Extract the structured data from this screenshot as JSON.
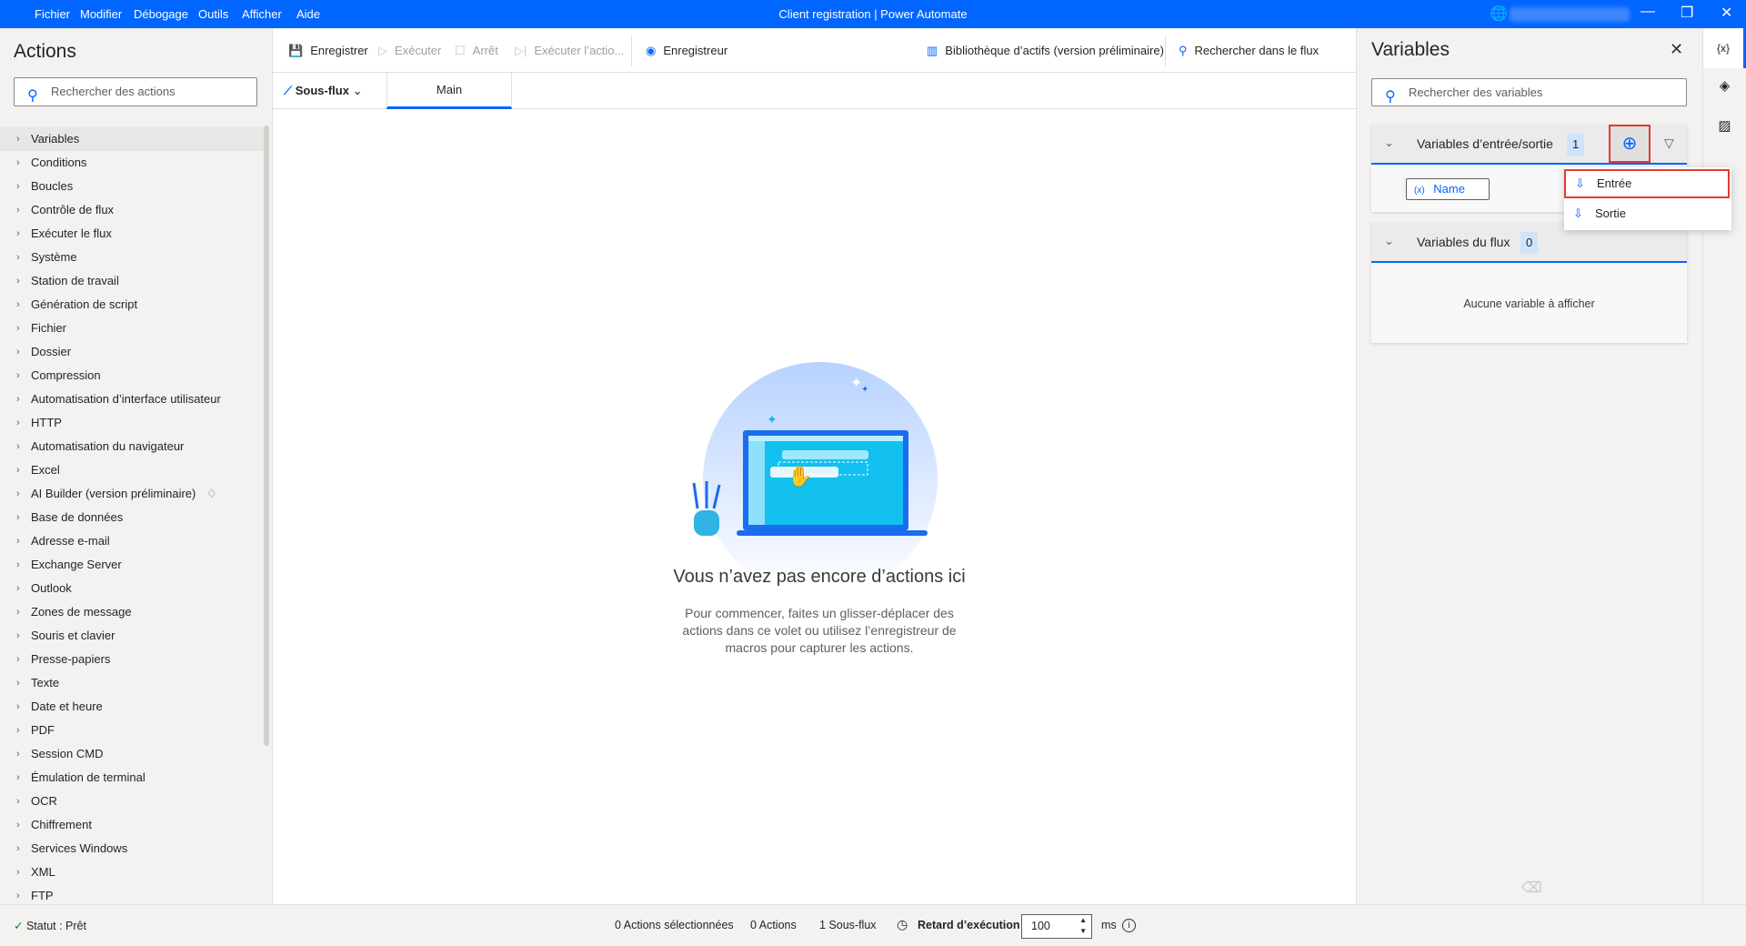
{
  "titlebar": {
    "menu": [
      "Fichier",
      "Modifier",
      "Débogage",
      "Outils",
      "Afficher",
      "Aide"
    ],
    "title": "Client registration | Power Automate"
  },
  "actions": {
    "title": "Actions",
    "search_placeholder": "Rechercher des actions",
    "items": [
      "Variables",
      "Conditions",
      "Boucles",
      "Contrôle de flux",
      "Exécuter le flux",
      "Système",
      "Station de travail",
      "Génération de script",
      "Fichier",
      "Dossier",
      "Compression",
      "Automatisation d’interface utilisateur",
      "HTTP",
      "Automatisation du navigateur",
      "Excel",
      "AI Builder (version préliminaire)",
      "Base de données",
      "Adresse e-mail",
      "Exchange Server",
      "Outlook",
      "Zones de message",
      "Souris et clavier",
      "Presse-papiers",
      "Texte",
      "Date et heure",
      "PDF",
      "Session CMD",
      "Émulation de terminal",
      "OCR",
      "Chiffrement",
      "Services Windows",
      "XML",
      "FTP"
    ]
  },
  "toolbar": {
    "save": "Enregistrer",
    "run": "Exécuter",
    "stop": "Arrêt",
    "run_action": "Exécuter l’actio...",
    "recorder": "Enregistreur",
    "library": "Bibliothèque d’actifs (version préliminaire)",
    "search_flow": "Rechercher dans le flux"
  },
  "tabs": {
    "subflows": "Sous-flux",
    "main": "Main"
  },
  "empty": {
    "heading": "Vous n’avez pas encore d’actions ici",
    "line1": "Pour commencer, faites un glisser-déplacer des",
    "line2": "actions dans ce volet ou utilisez l’enregistreur de",
    "line3": "macros pour capturer les actions."
  },
  "variables": {
    "title": "Variables",
    "search_placeholder": "Rechercher des variables",
    "io": {
      "label": "Variables d’entrée/sortie",
      "count": "1",
      "vars": [
        "Name"
      ]
    },
    "flow": {
      "label": "Variables du flux",
      "count": "0",
      "empty": "Aucune variable à afficher"
    },
    "menu": {
      "input": "Entrée",
      "output": "Sortie"
    }
  },
  "status": {
    "state": "Statut : Prêt",
    "selected": "0 Actions sélectionnées",
    "actions": "0 Actions",
    "subflows": "1 Sous-flux",
    "delay_label": "Retard d’exécution",
    "delay_value": "100",
    "unit": "ms"
  },
  "colors": {
    "accent": "#0066ff",
    "highlight": "#e53935",
    "status_ok": "#107c10"
  }
}
